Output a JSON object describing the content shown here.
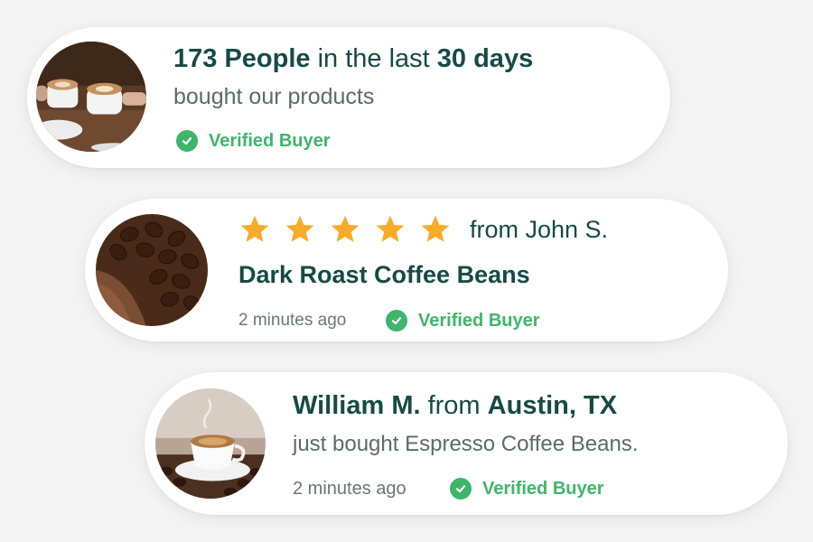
{
  "card1": {
    "count": "173 People",
    "mid": " in the last ",
    "period": "30 days",
    "line2": "bought our products",
    "verified_label": "Verified Buyer",
    "image": "coffee-cups-cheers-image"
  },
  "card2": {
    "rating": 5,
    "rating_max": 5,
    "from": "from John S.",
    "product": "Dark Roast Coffee Beans",
    "time": "2 minutes ago",
    "verified_label": "Verified Buyer",
    "image": "coffee-beans-grounds-image"
  },
  "card3": {
    "name": "William M.",
    "from_word": " from ",
    "location": "Austin, TX",
    "line2": "just bought Espresso Coffee Beans.",
    "time": "2 minutes ago",
    "verified_label": "Verified Buyer",
    "image": "espresso-cup-image"
  },
  "colors": {
    "heading": "#174a45",
    "verified": "#3fb56a",
    "star": "#fbaa2a",
    "background": "#f3f3f3"
  }
}
